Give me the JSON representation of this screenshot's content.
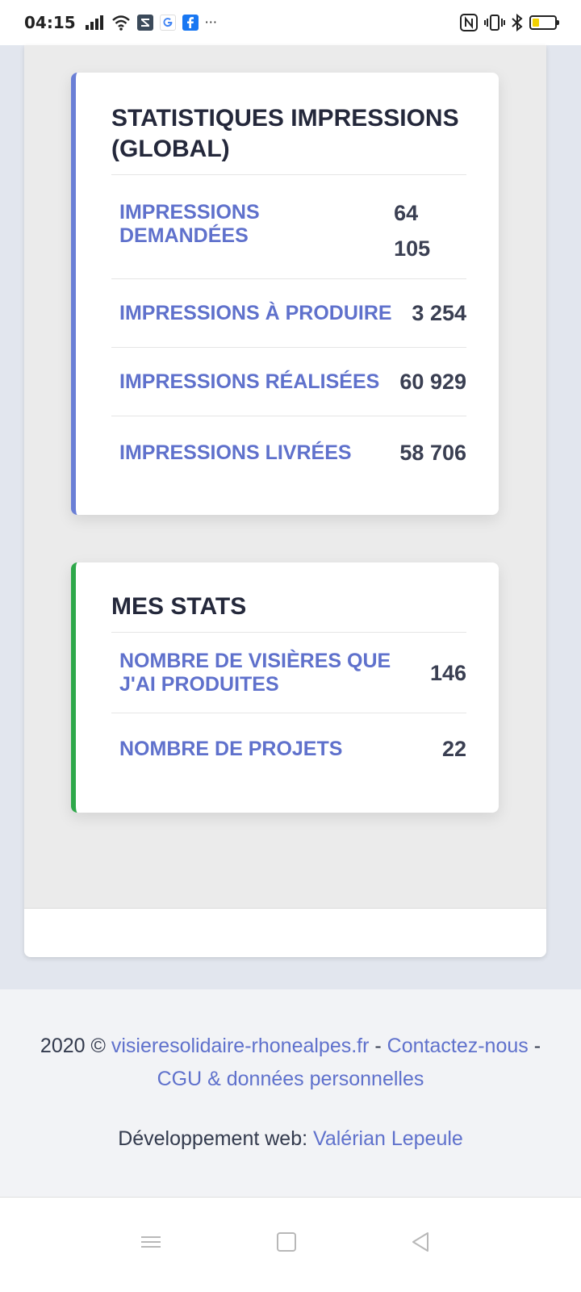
{
  "status_bar": {
    "time": "04:15",
    "icons": [
      "signal-icon",
      "wifi-icon",
      "notification-app-icon",
      "google-icon",
      "facebook-icon",
      "more-icon",
      "nfc-icon",
      "vibrate-icon",
      "bluetooth-icon",
      "battery-icon"
    ],
    "more_glyph": "···"
  },
  "cards": {
    "global": {
      "title": "STATISTIQUES IMPRESSIONS (GLOBAL)",
      "accent": "#6a7fd6",
      "rows": [
        {
          "label": "IMPRESSIONS DEMANDÉES",
          "value_line1": "64",
          "value_line2": "105"
        },
        {
          "label": "IMPRESSIONS À PRODUIRE",
          "value": "3 254"
        },
        {
          "label": "IMPRESSIONS RÉALISÉES",
          "value": "60 929"
        },
        {
          "label": "IMPRESSIONS LIVRÉES",
          "value": "58 706"
        }
      ]
    },
    "mine": {
      "title": "MES STATS",
      "accent": "#2ea84a",
      "rows": [
        {
          "label": "NOMBRE DE VISIÈRES QUE J'AI PRODUITES",
          "value": "146"
        },
        {
          "label": "NOMBRE DE PROJETS",
          "value": "22"
        }
      ]
    }
  },
  "footer": {
    "copyright": "2020 ©",
    "site_link": "visieresolidaire-rhonealpes.fr",
    "sep1": " - ",
    "contact_link": "Contactez-nous",
    "sep2": " - ",
    "cgu_link": "CGU & données personnelles",
    "dev_prefix": "Développement web:",
    "dev_link": "Valérian Lepeule"
  },
  "colors": {
    "link": "#5f71cc",
    "title": "#24283b",
    "battery_level": "#f2d100"
  }
}
